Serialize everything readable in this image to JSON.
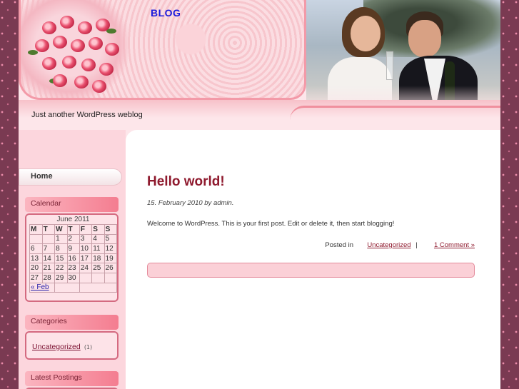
{
  "site": {
    "title": "BLOG",
    "tagline": "Just another WordPress weblog"
  },
  "nav": {
    "home_label": "Home"
  },
  "calendar": {
    "widget_title": "Calendar",
    "caption": "June 2011",
    "weekdays": [
      "M",
      "T",
      "W",
      "T",
      "F",
      "S",
      "S"
    ],
    "weeks": [
      [
        "",
        "",
        "1",
        "2",
        "3",
        "4",
        "5"
      ],
      [
        "6",
        "7",
        "8",
        "9",
        "10",
        "11",
        "12"
      ],
      [
        "13",
        "14",
        "15",
        "16",
        "17",
        "18",
        "19"
      ],
      [
        "20",
        "21",
        "22",
        "23",
        "24",
        "25",
        "26"
      ],
      [
        "27",
        "28",
        "29",
        "30",
        "",
        "",
        ""
      ]
    ],
    "prev_link": "« Feb"
  },
  "categories": {
    "widget_title": "Categories",
    "items": [
      {
        "label": "Uncategorized",
        "count": "(1)"
      }
    ]
  },
  "latest": {
    "widget_title": "Latest Postings"
  },
  "post": {
    "title": "Hello world!",
    "meta": "15. February 2010 by admin.",
    "body": "Welcome to WordPress. This is your first post. Edit or delete it, then start blogging!",
    "posted_in_label": "Posted in",
    "category_link": "Uncategorized",
    "separator": "|",
    "comments_link": "1 Comment »"
  }
}
